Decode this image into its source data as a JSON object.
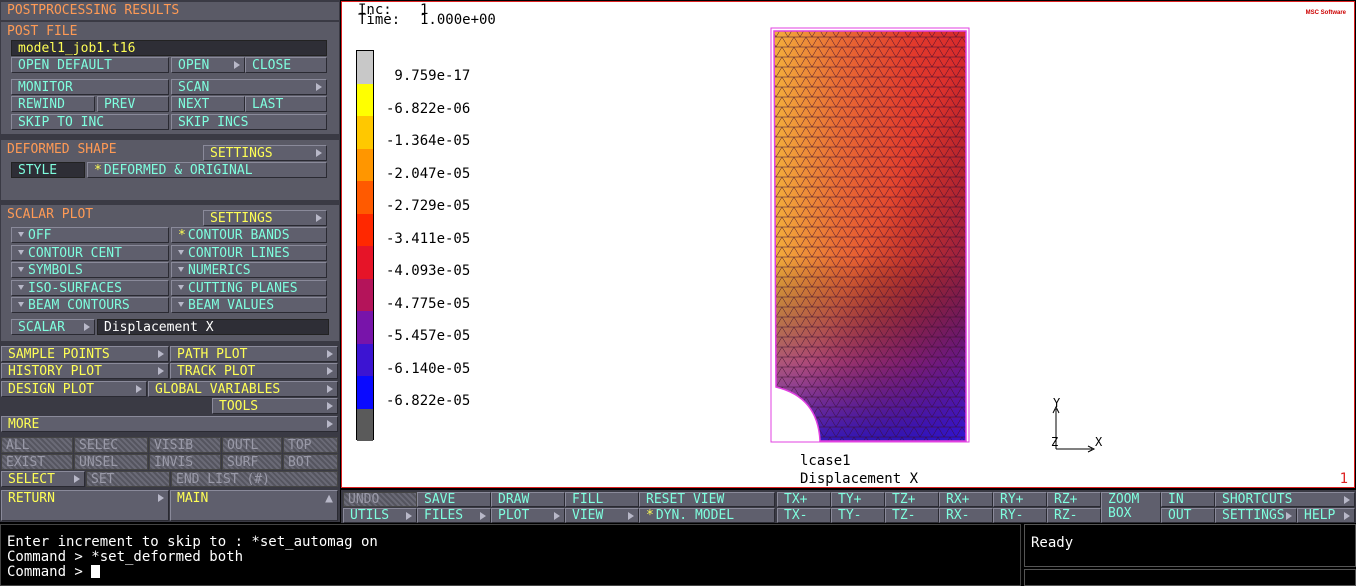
{
  "menu": {
    "title": "POSTPROCESSING RESULTS",
    "post_file": {
      "heading": "POST FILE",
      "filename": "model1_job1.t16",
      "open_default": "OPEN DEFAULT",
      "open": "OPEN",
      "close": "CLOSE",
      "monitor": "MONITOR",
      "scan": "SCAN",
      "rewind": "REWIND",
      "prev": "PREV",
      "next": "NEXT",
      "last": "LAST",
      "skip_to_inc": "SKIP TO INC",
      "skip_incs": "SKIP INCS"
    },
    "deformed_shape": {
      "heading": "DEFORMED SHAPE",
      "settings": "SETTINGS",
      "style_label": "STYLE",
      "style_value": "DEFORMED & ORIGINAL"
    },
    "scalar_plot": {
      "heading": "SCALAR PLOT",
      "settings": "SETTINGS",
      "off": "OFF",
      "contour_bands": "CONTOUR BANDS",
      "contour_cent": "CONTOUR CENT",
      "contour_lines": "CONTOUR LINES",
      "symbols": "SYMBOLS",
      "numerics": "NUMERICS",
      "iso_surfaces": "ISO-SURFACES",
      "cutting_planes": "CUTTING PLANES",
      "beam_contours": "BEAM CONTOURS",
      "beam_values": "BEAM VALUES",
      "scalar_label": "SCALAR",
      "scalar_value": "Displacement X"
    },
    "sample_points": "SAMPLE POINTS",
    "path_plot": "PATH PLOT",
    "history_plot": "HISTORY PLOT",
    "track_plot": "TRACK PLOT",
    "design_plot": "DESIGN PLOT",
    "global_variables": "GLOBAL VARIABLES",
    "tools": "TOOLS",
    "more": "MORE",
    "select_row1": [
      "ALL",
      "SELEC",
      "VISIB",
      "OUTL",
      "TOP"
    ],
    "select_row2": [
      "EXIST",
      "UNSEL",
      "INVIS",
      "SURF",
      "BOT"
    ],
    "select": "SELECT",
    "set": "SET",
    "end_list": "END LIST (#)",
    "return": "RETURN",
    "main": "MAIN"
  },
  "viewport": {
    "inc_label": "Inc:",
    "inc_value": "1",
    "time_label": "Time:",
    "time_value": "1.000e+00",
    "legend_values": [
      "9.759e-17",
      "-6.822e-06",
      "-1.364e-05",
      "-2.047e-05",
      "-2.729e-05",
      "-3.411e-05",
      "-4.093e-05",
      "-4.775e-05",
      "-5.457e-05",
      "-6.140e-05",
      "-6.822e-05"
    ],
    "legend_colors": [
      "#c8c8c8",
      "#ffff00",
      "#ffc800",
      "#ff9600",
      "#ff5a00",
      "#ff2800",
      "#e61428",
      "#b4145a",
      "#7814aa",
      "#3c14d2",
      "#0a0aff",
      "#5a5a5a"
    ],
    "loadcase": "lcase1",
    "variable": "Displacement X",
    "window_number": "1",
    "logo": "MSC Software",
    "axis_y": "Y",
    "axis_x": "X",
    "axis_z": "Z"
  },
  "toolbar": {
    "undo": "UNDO",
    "utils": "UTILS",
    "save": "SAVE",
    "files": "FILES",
    "draw": "DRAW",
    "plot": "PLOT",
    "fill": "FILL",
    "view": "VIEW",
    "reset_view": "RESET VIEW",
    "dyn_model": "DYN. MODEL",
    "txp": "TX+",
    "txm": "TX-",
    "typ": "TY+",
    "tym": "TY-",
    "tzp": "TZ+",
    "tzm": "TZ-",
    "rxp": "RX+",
    "rxm": "RX-",
    "ryp": "RY+",
    "rym": "RY-",
    "rzp": "RZ+",
    "rzm": "RZ-",
    "zoom": "ZOOM",
    "box": "BOX",
    "in": "IN",
    "out": "OUT",
    "shortcuts": "SHORTCUTS",
    "settings": "SETTINGS",
    "help": "HELP"
  },
  "command": {
    "line1": "Enter increment to skip to : *set_automag on",
    "line2": "Command > *set_deformed both",
    "line3": "Command > "
  },
  "status": "Ready"
}
